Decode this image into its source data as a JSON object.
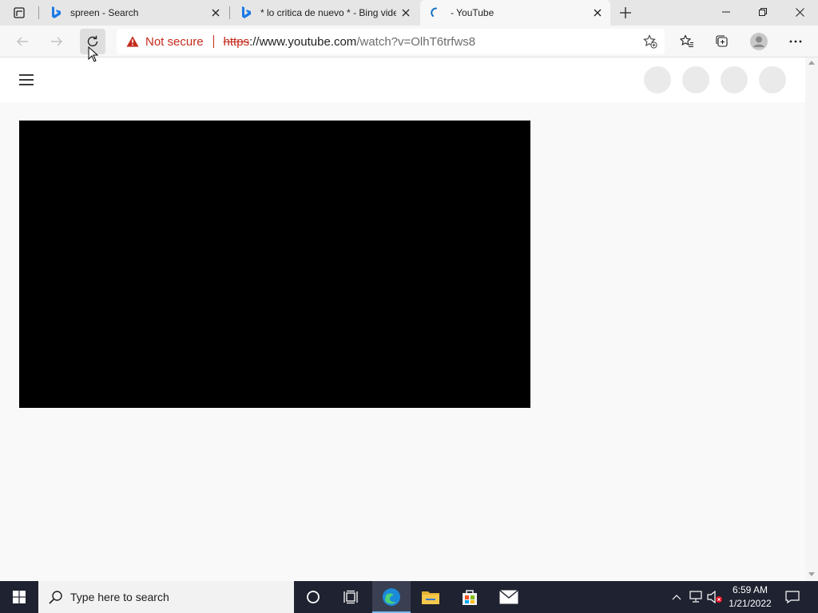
{
  "browser": {
    "tabs": [
      {
        "title": "spreen - Search",
        "favicon": "bing-icon",
        "active": false
      },
      {
        "title": "* lo critica de nuevo * - Bing vide",
        "favicon": "bing-icon",
        "active": false
      },
      {
        "title": "- YouTube",
        "favicon": "loading-spinner-icon",
        "active": true
      }
    ],
    "address_bar": {
      "security_text": "Not secure",
      "url_scheme": "https",
      "url_host": "://www.youtube.com",
      "url_path": "/watch?v=OlhT6trfws8"
    },
    "colors": {
      "not_secure": "#c42b1c",
      "accent": "#76b9ed"
    }
  },
  "page": {
    "video_player_color": "#000000"
  },
  "taskbar": {
    "search_placeholder": "Type here to search",
    "apps": [
      "task-view-icon",
      "edge-icon",
      "file-explorer-icon",
      "store-icon",
      "mail-icon"
    ],
    "clock_time": "6:59 AM",
    "clock_date": "1/21/2022"
  }
}
